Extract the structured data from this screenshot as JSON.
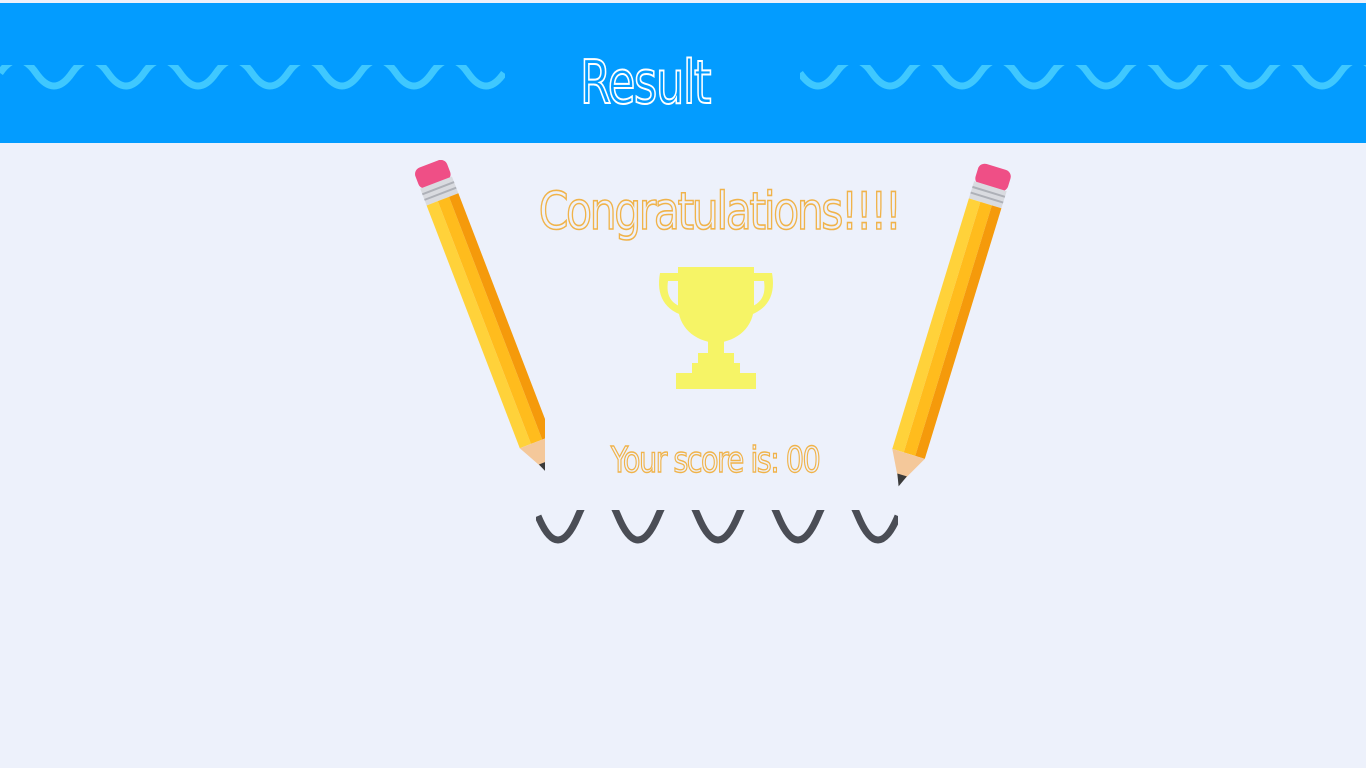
{
  "header": {
    "title": "Result",
    "background_color": "#039cff",
    "wave_color": "#3fc8ff"
  },
  "result": {
    "congrats_text": "Congratulations!!!!",
    "score_prefix": "Your score is: ",
    "score_value": "00",
    "text_color": "#f0b34a"
  },
  "trophy": {
    "icon": "trophy-icon",
    "color": "#f6f466"
  },
  "decorations": {
    "left_pencil": "pencil-icon",
    "right_pencil": "pencil-icon",
    "underline": "squiggle-underline",
    "underline_color": "#4a4d55"
  }
}
